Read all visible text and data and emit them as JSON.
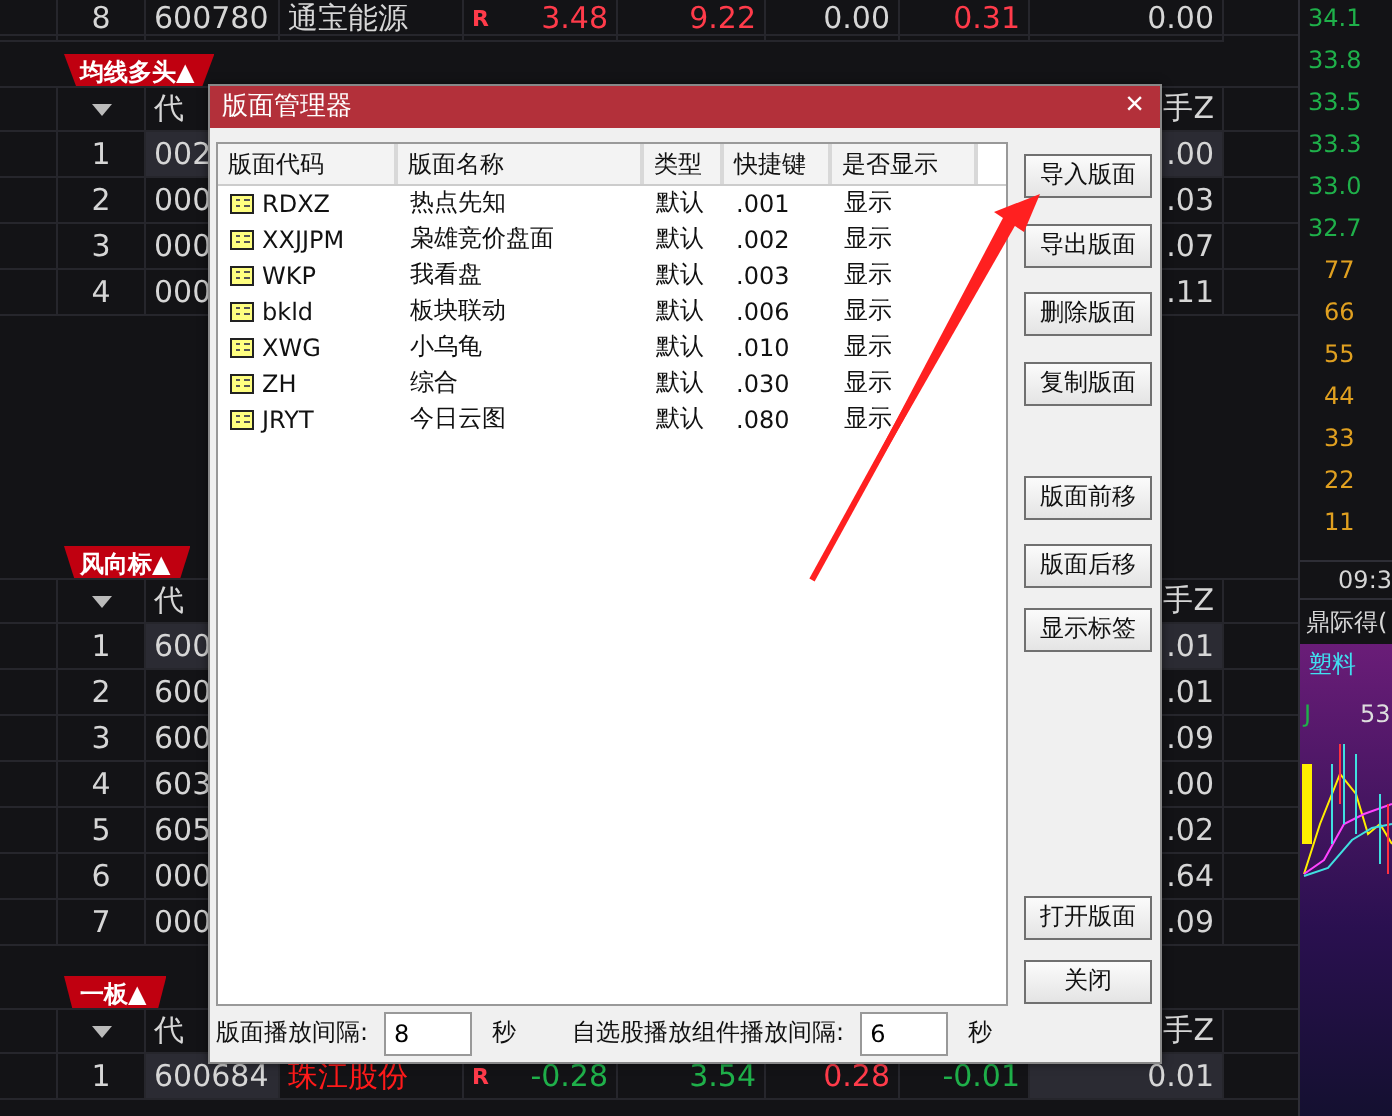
{
  "top_row": {
    "index": "8",
    "code": "600780",
    "name": {
      "text": "通宝能源",
      "color": "#d6d6d6"
    },
    "flag": "R",
    "values": [
      {
        "text": "3.48",
        "color": "#ff3b4a"
      },
      {
        "text": "9.22",
        "color": "#ff3b4a"
      },
      {
        "text": "0.00",
        "color": "#d6d6d6"
      },
      {
        "text": "0.31",
        "color": "#ff3b4a"
      }
    ],
    "turnover": "0.00"
  },
  "sections": [
    {
      "title": "均线多头▲",
      "header": {
        "code": "代",
        "turnover": "手Z"
      },
      "rows": [
        {
          "index": "1",
          "code": "002",
          "turnover": ".00",
          "selected": true
        },
        {
          "index": "2",
          "code": "000",
          "turnover": ".03",
          "selected": false
        },
        {
          "index": "3",
          "code": "000",
          "turnover": ".07",
          "selected": false
        },
        {
          "index": "4",
          "code": "000",
          "turnover": ".11",
          "selected": false
        }
      ]
    },
    {
      "title": "风向标▲",
      "header": {
        "code": "代",
        "turnover": "手Z"
      },
      "rows": [
        {
          "index": "1",
          "code": "600",
          "turnover": ".01",
          "selected": true
        },
        {
          "index": "2",
          "code": "600",
          "turnover": ".01",
          "selected": false
        },
        {
          "index": "3",
          "code": "600",
          "turnover": ".09",
          "selected": false
        },
        {
          "index": "4",
          "code": "603",
          "turnover": ".00",
          "selected": false
        },
        {
          "index": "5",
          "code": "605",
          "turnover": ".02",
          "selected": false
        },
        {
          "index": "6",
          "code": "000",
          "turnover": ".64",
          "selected": false
        },
        {
          "index": "7",
          "code": "000",
          "turnover": ".09",
          "selected": false
        }
      ]
    },
    {
      "title": "一板▲",
      "header": {
        "code": "代",
        "turnover": "手Z"
      },
      "rows": [
        {
          "index": "1",
          "code": "600684",
          "name": {
            "text": "珠江股份",
            "color": "#ff1a1a"
          },
          "flag": "R",
          "values": [
            {
              "text": "-0.28",
              "color": "#1fb04a"
            },
            {
              "text": "3.54",
              "color": "#1fb04a"
            },
            {
              "text": "0.28",
              "color": "#ff3b4a"
            },
            {
              "text": "-0.01",
              "color": "#1fb04a"
            }
          ],
          "turnover": "0.01",
          "selected": true
        }
      ]
    }
  ],
  "side_panel": {
    "prices": [
      "34.1",
      "33.8",
      "33.5",
      "33.3",
      "33.0",
      "32.7"
    ],
    "volumes": [
      "77",
      "66",
      "55",
      "44",
      "33",
      "22",
      "11"
    ],
    "time": "09:3",
    "stock_name": "鼎际得(",
    "sector": "塑料",
    "indicator": "J",
    "marker": "53"
  },
  "dialog": {
    "title": "版面管理器",
    "close": "×",
    "columns": [
      "版面代码",
      "版面名称",
      "类型",
      "快捷键",
      "是否显示"
    ],
    "rows": [
      {
        "code": "RDXZ",
        "name": "热点先知",
        "type": "默认",
        "shortcut": ".001",
        "display": "显示"
      },
      {
        "code": "XXJJPM",
        "name": "枭雄竞价盘面",
        "type": "默认",
        "shortcut": ".002",
        "display": "显示"
      },
      {
        "code": "WKP",
        "name": "我看盘",
        "type": "默认",
        "shortcut": ".003",
        "display": "显示"
      },
      {
        "code": "bkld",
        "name": "板块联动",
        "type": "默认",
        "shortcut": ".006",
        "display": "显示"
      },
      {
        "code": "XWG",
        "name": "小乌龟",
        "type": "默认",
        "shortcut": ".010",
        "display": "显示"
      },
      {
        "code": "ZH",
        "name": "综合",
        "type": "默认",
        "shortcut": ".030",
        "display": "显示"
      },
      {
        "code": "JRYT",
        "name": "今日云图",
        "type": "默认",
        "shortcut": ".080",
        "display": "显示"
      }
    ],
    "buttons": [
      "导入版面",
      "导出版面",
      "删除版面",
      "复制版面",
      "版面前移",
      "版面后移",
      "显示标签",
      "打开版面",
      "关闭"
    ],
    "settings": [
      {
        "label": "版面播放间隔:",
        "value": "8",
        "unit": "秒"
      },
      {
        "label": "自选股播放组件播放间隔:",
        "value": "6",
        "unit": "秒"
      }
    ]
  }
}
